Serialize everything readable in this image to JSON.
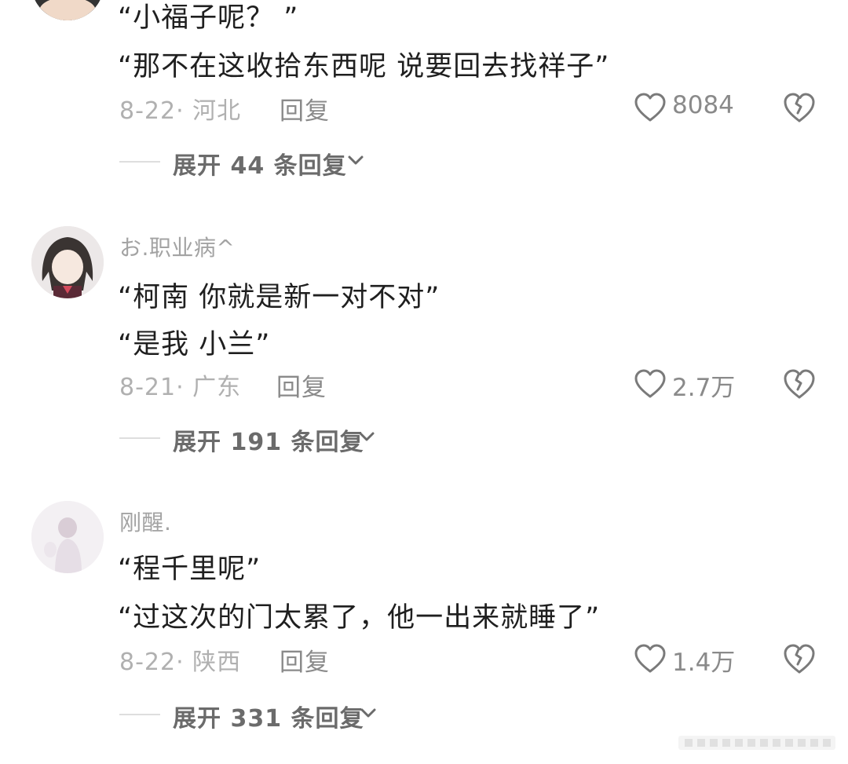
{
  "comments": [
    {
      "username": "",
      "lines": [
        "“小福子呢？ ”",
        "“那不在这收拾东西呢 说要回去找祥子”"
      ],
      "meta": {
        "date_location": "8-22· 河北",
        "reply_label": "回复",
        "like_count": "8084"
      },
      "expand_label": "展开 44 条回复"
    },
    {
      "username": "お.职业病^",
      "lines": [
        "“柯南 你就是新一对不对”",
        "“是我 小兰”"
      ],
      "meta": {
        "date_location": "8-21· 广东",
        "reply_label": "回复",
        "like_count": "2.7万"
      },
      "expand_label": "展开 191 条回复"
    },
    {
      "username": "刚醒.",
      "lines": [
        "“程千里呢”",
        "“过这次的门太累了，他一出来就睡了”"
      ],
      "meta": {
        "date_location": "8-22· 陕西",
        "reply_label": "回复",
        "like_count": "1.4万"
      },
      "expand_label": "展开 331 条回复"
    }
  ],
  "icons": {
    "like": "heart-outline-icon",
    "dislike": "broken-heart-icon",
    "expand": "chevron-down-icon"
  },
  "colors": {
    "text_primary": "#1f1f1f",
    "text_secondary": "#a3a3a3",
    "icon": "#8a8a8a"
  }
}
